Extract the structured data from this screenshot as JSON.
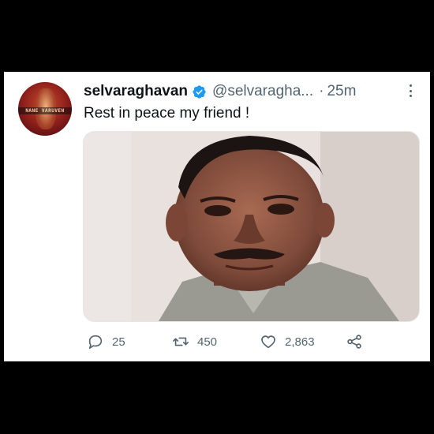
{
  "tweet": {
    "display_name": "selvaraghavan",
    "handle": "@selvaragha...",
    "separator": "·",
    "time": "25m",
    "text": "Rest in peace my friend !",
    "avatar_text": "NANE VARUVEN",
    "verified_color": "#1d9bf0",
    "icons": [
      "verified-badge-icon",
      "more-options-icon",
      "reply-icon",
      "retweet-icon",
      "like-icon",
      "share-icon"
    ],
    "actions": {
      "replies": "25",
      "retweets": "450",
      "likes": "2,863"
    }
  }
}
